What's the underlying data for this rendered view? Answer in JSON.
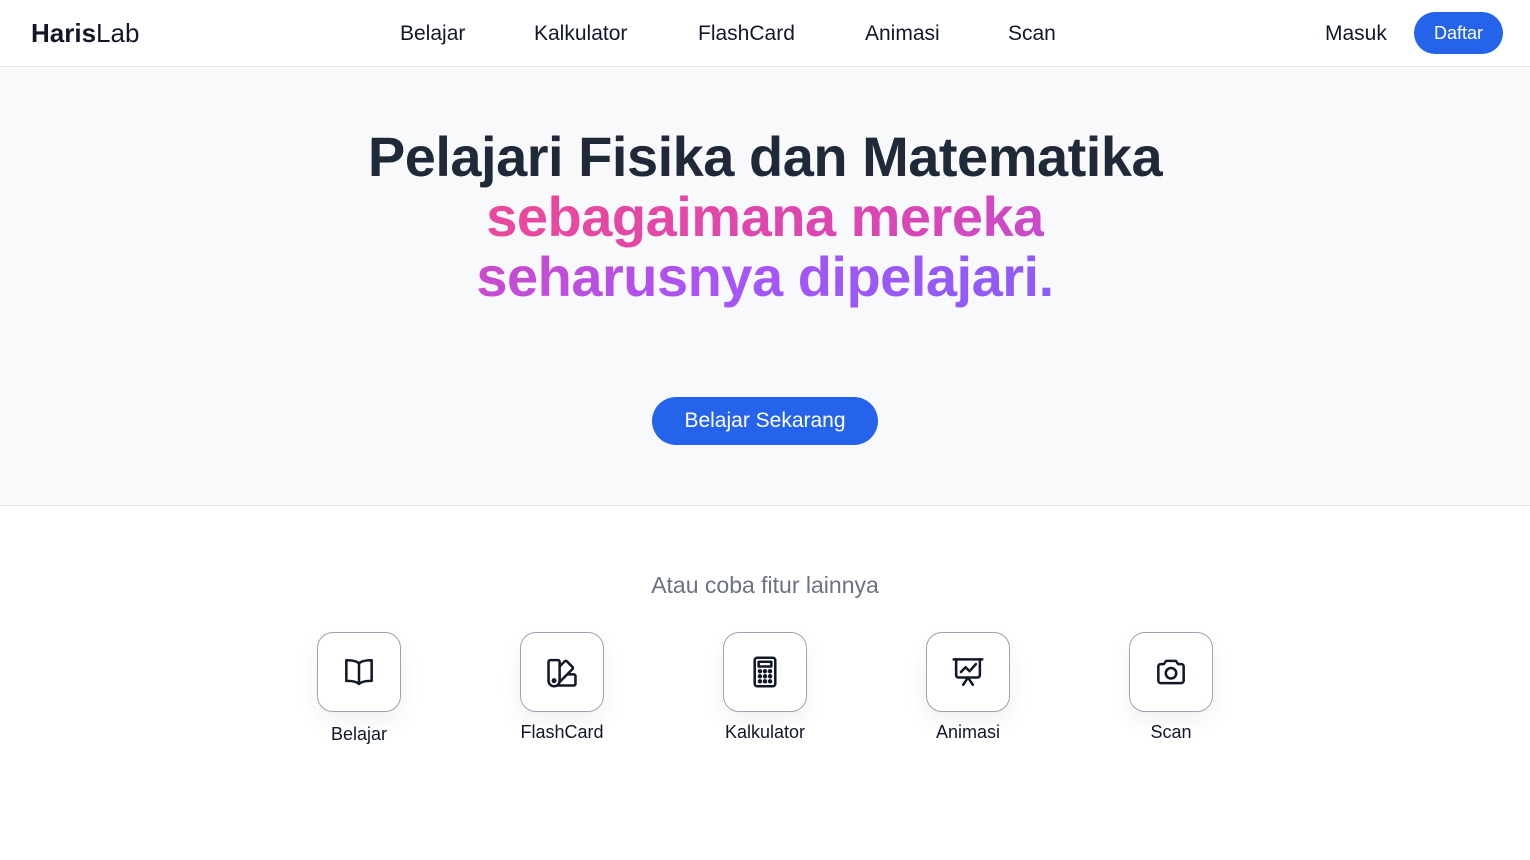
{
  "header": {
    "logo_bold": "Haris",
    "logo_light": "Lab",
    "nav": [
      {
        "label": "Belajar"
      },
      {
        "label": "Kalkulator"
      },
      {
        "label": "FlashCard"
      },
      {
        "label": "Animasi"
      },
      {
        "label": "Scan"
      }
    ],
    "login_label": "Masuk",
    "register_label": "Daftar"
  },
  "hero": {
    "title_part1": "Pelajari Fisika dan Matematika ",
    "title_part2": "sebagaimana mereka seharusnya dipelajari.",
    "cta_label": "Belajar Sekarang"
  },
  "features": {
    "subtitle": "Atau coba fitur lainnya",
    "items": [
      {
        "label": "Belajar",
        "icon": "book-open-icon"
      },
      {
        "label": "FlashCard",
        "icon": "swatch-icon"
      },
      {
        "label": "Kalkulator",
        "icon": "calculator-icon"
      },
      {
        "label": "Animasi",
        "icon": "presentation-chart-icon"
      },
      {
        "label": "Scan",
        "icon": "camera-icon"
      }
    ]
  },
  "colors": {
    "primary": "#2563eb",
    "gradient_start": "#ec4899",
    "gradient_end": "#8b5cf6",
    "text_dark": "#1f2937",
    "muted": "#6b7280"
  }
}
